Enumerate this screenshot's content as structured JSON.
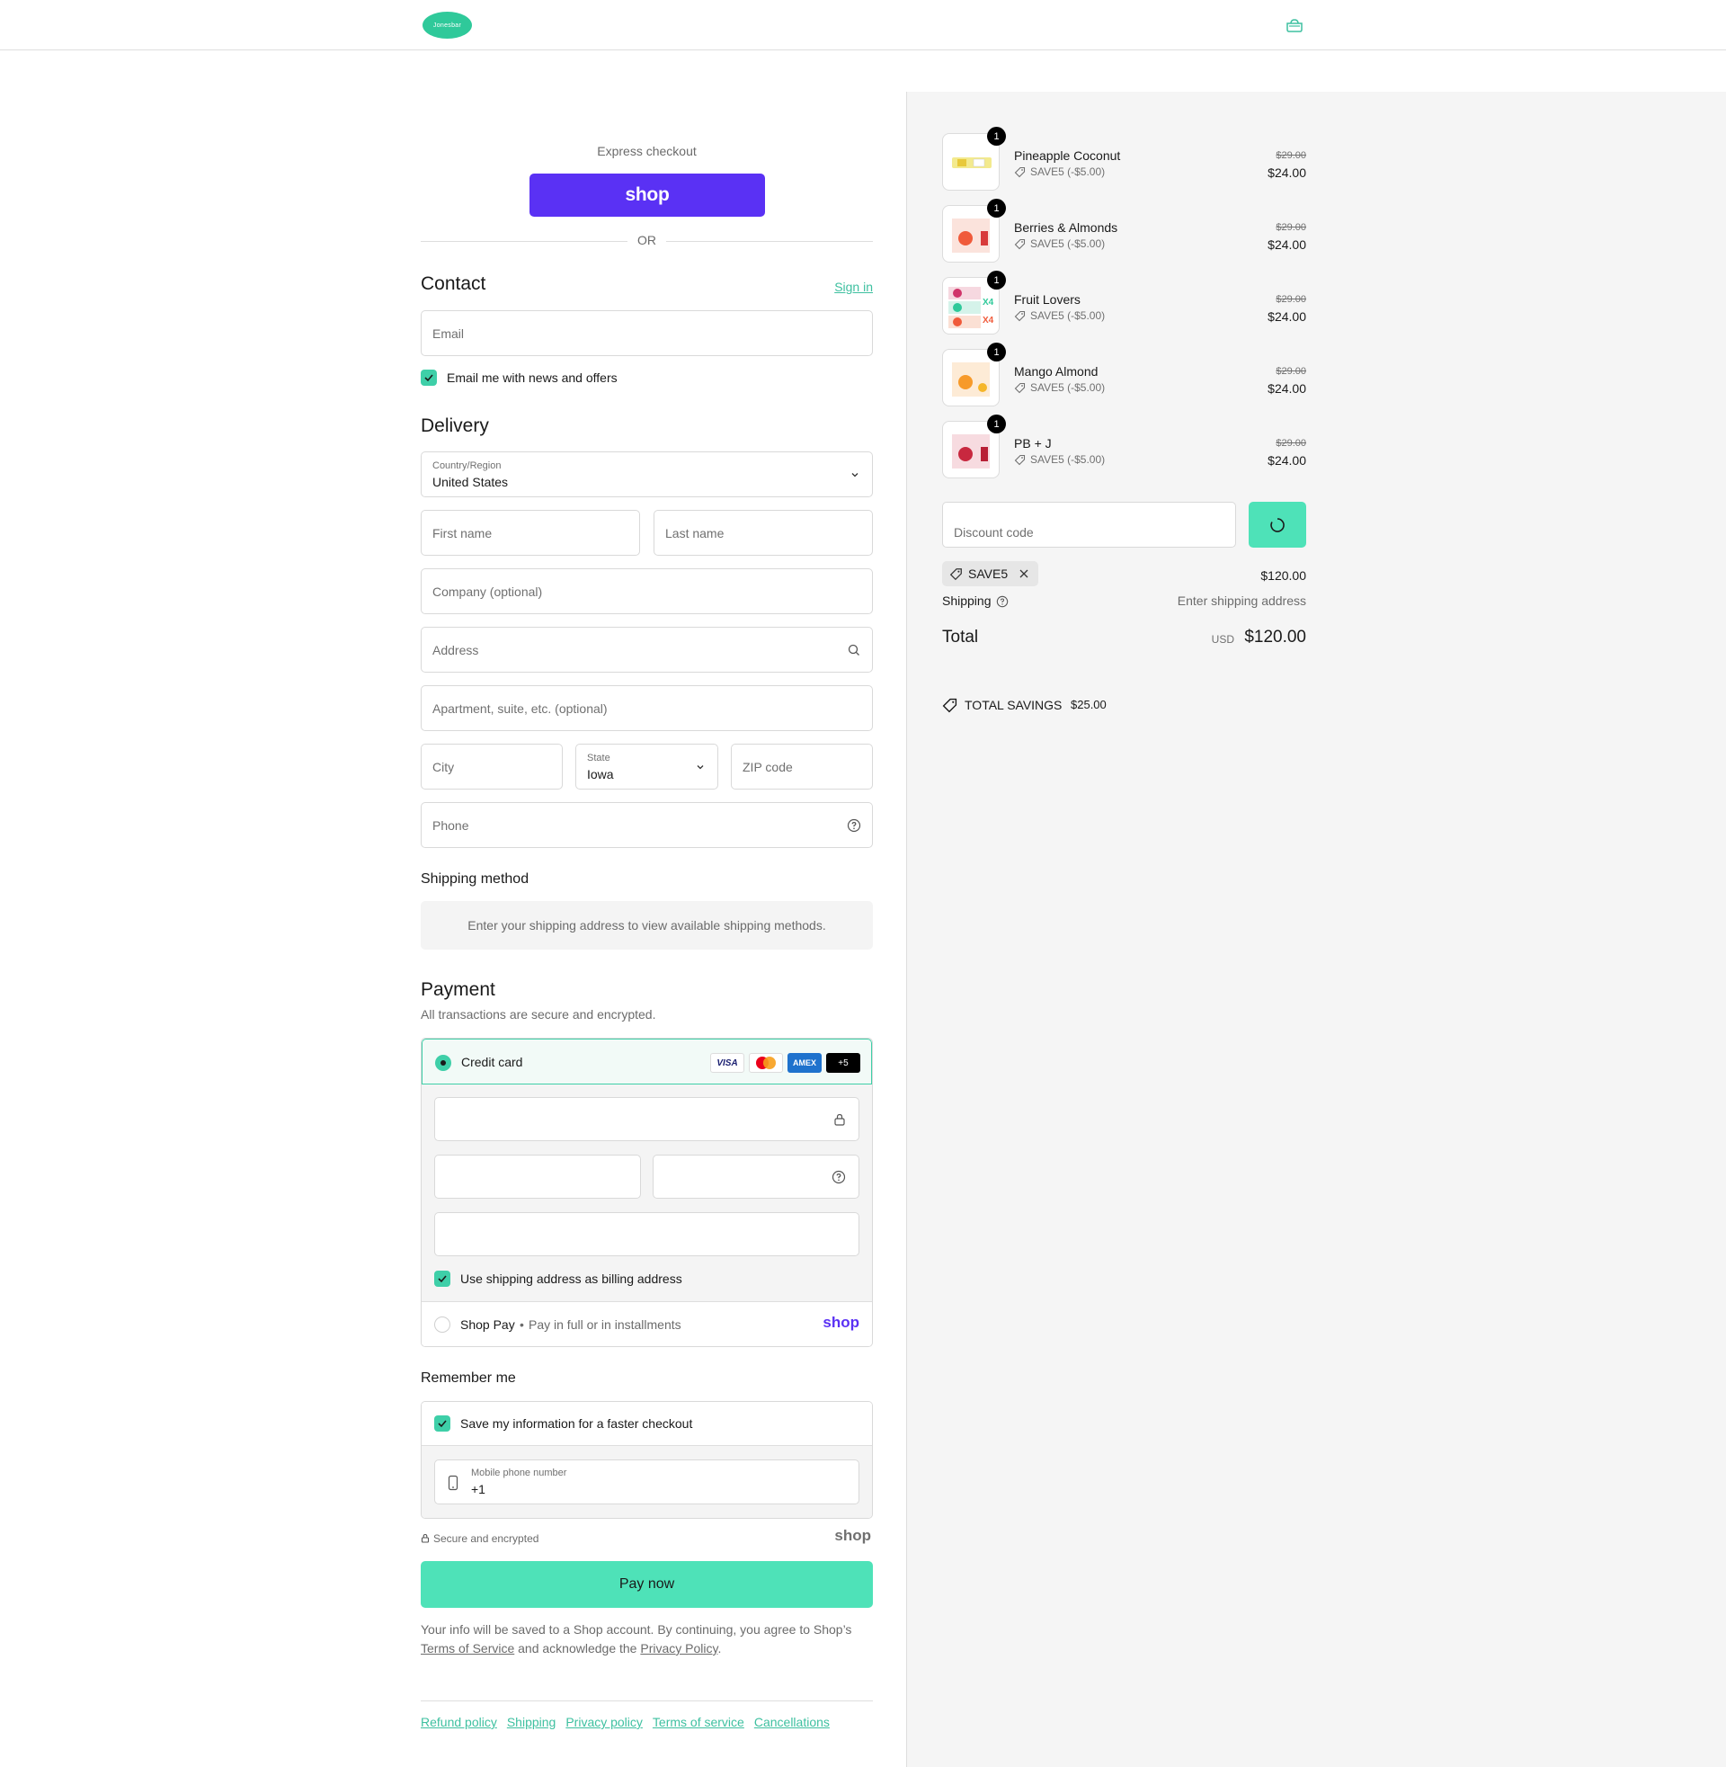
{
  "header": {
    "logo_text": "Jonesbar",
    "cart_icon": "bag-icon"
  },
  "express": {
    "label": "Express checkout",
    "shop_button": "shop",
    "or": "OR"
  },
  "contact": {
    "title": "Contact",
    "sign_in": "Sign in",
    "email_placeholder": "Email",
    "news_label": "Email me with news and offers"
  },
  "delivery": {
    "title": "Delivery",
    "country_label": "Country/Region",
    "country_value": "United States",
    "first_name": "First name",
    "last_name": "Last name",
    "company": "Company (optional)",
    "address": "Address",
    "apartment": "Apartment, suite, etc. (optional)",
    "city": "City",
    "state_label": "State",
    "state_value": "Iowa",
    "zip": "ZIP code",
    "phone": "Phone"
  },
  "shipping_method": {
    "title": "Shipping method",
    "message": "Enter your shipping address to view available shipping methods."
  },
  "payment": {
    "title": "Payment",
    "subtitle": "All transactions are secure and encrypted.",
    "credit_card": "Credit card",
    "cards": [
      "VISA",
      "MC",
      "AMEX",
      "+5"
    ],
    "billing_label": "Use shipping address as billing address",
    "shop_pay": "Shop Pay",
    "shop_pay_sub": "Pay in full or in installments",
    "shop_pay_logo": "shop"
  },
  "remember": {
    "title": "Remember me",
    "save_label": "Save my information for a faster checkout",
    "mobile_label": "Mobile phone number",
    "mobile_value": "+1",
    "secure": "Secure and encrypted",
    "shop_logo": "shop"
  },
  "pay_now": "Pay now",
  "legal": {
    "text1": "Your info will be saved to a Shop account. By continuing, you agree to Shop’s",
    "terms": "Terms of Service",
    "text2": " and acknowledge the ",
    "privacy": "Privacy Policy",
    "text3": "."
  },
  "footer": [
    "Refund policy",
    "Shipping",
    "Privacy policy",
    "Terms of service",
    "Cancellations"
  ],
  "summary": {
    "items": [
      {
        "name": "Pineapple Coconut",
        "qty": "1",
        "discount": "SAVE5 (-$5.00)",
        "old_price": "$29.00",
        "price": "$24.00"
      },
      {
        "name": "Berries & Almonds",
        "qty": "1",
        "discount": "SAVE5 (-$5.00)",
        "old_price": "$29.00",
        "price": "$24.00"
      },
      {
        "name": "Fruit Lovers",
        "qty": "1",
        "discount": "SAVE5 (-$5.00)",
        "old_price": "$29.00",
        "price": "$24.00"
      },
      {
        "name": "Mango Almond",
        "qty": "1",
        "discount": "SAVE5 (-$5.00)",
        "old_price": "$29.00",
        "price": "$24.00"
      },
      {
        "name": "PB + J",
        "qty": "1",
        "discount": "SAVE5 (-$5.00)",
        "old_price": "$29.00",
        "price": "$24.00"
      }
    ],
    "discount_placeholder": "Discount code",
    "applied_code": "SAVE5",
    "subtotal": "$120.00",
    "shipping_label": "Shipping",
    "shipping_value": "Enter shipping address",
    "total_label": "Total",
    "currency": "USD",
    "total": "$120.00",
    "savings_label": "TOTAL SAVINGS",
    "savings_value": "$25.00"
  },
  "colors": {
    "accent": "#4ee2b8",
    "shop_purple": "#5a31f4",
    "link": "#3ec0a0"
  }
}
